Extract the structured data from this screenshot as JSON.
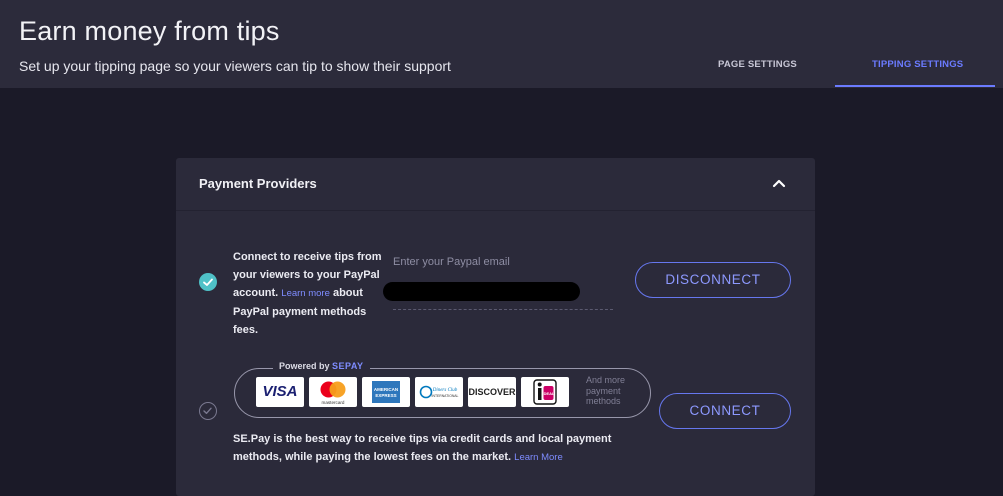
{
  "header": {
    "title": "Earn money from tips",
    "subtitle": "Set up your tipping page so your viewers can tip to show their support",
    "tabs": [
      {
        "label": "PAGE SETTINGS",
        "active": false
      },
      {
        "label": "TIPPING SETTINGS",
        "active": true
      }
    ]
  },
  "colors": {
    "accent": "#6b7bff",
    "check": "#4fc1c7",
    "background": "#1b1a28",
    "panel": "#2b2a3a"
  },
  "panel": {
    "title": "Payment Providers",
    "collapse_icon": "chevron-up-icon"
  },
  "paypal": {
    "connected": true,
    "desc_before": "Connect to receive tips from your viewers to your PayPal account. ",
    "learn_more": "Learn more",
    "desc_after": " about PayPal payment methods fees.",
    "email_label": "Enter your Paypal email",
    "button_label": "DISCONNECT"
  },
  "sepay": {
    "connected": false,
    "powered_by": "Powered by",
    "brand": "SEPAY",
    "cards": [
      "VISA",
      "mastercard",
      "American Express",
      "Diners Club International",
      "DISCOVER",
      "iDEAL"
    ],
    "card_texts": {
      "visa": "VISA",
      "mastercard": "mastercard",
      "amex_1": "AMERICAN",
      "amex_2": "EXPRESS",
      "diners_1": "Diners Club",
      "diners_2": "INTERNATIONAL",
      "discover": "DISCOVER",
      "ideal": "iDEAL"
    },
    "more_text": "And more payment methods",
    "desc": "SE.Pay is the best way to receive tips via credit cards and local payment methods, while paying the lowest fees on the market. ",
    "learn_more": "Learn More",
    "button_label": "CONNECT"
  }
}
